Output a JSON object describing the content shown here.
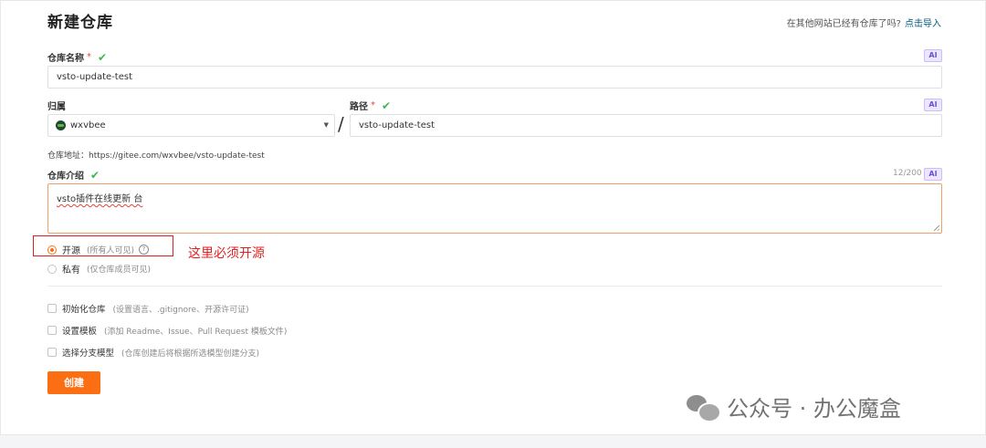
{
  "header": {
    "title": "新建仓库",
    "import_prompt": "在其他网站已经有仓库了吗?",
    "import_link": "点击导入"
  },
  "repo_name": {
    "label": "仓库名称",
    "required_mark": "*",
    "value": "vsto-update-test",
    "ai_badge": "AI"
  },
  "owner": {
    "label": "归属",
    "value": "wxvbee"
  },
  "separator": "/",
  "path": {
    "label": "路径",
    "required_mark": "*",
    "value": "vsto-update-test",
    "ai_badge": "AI"
  },
  "address": "仓库地址：https://gitee.com/wxvbee/vsto-update-test",
  "description": {
    "label": "仓库介绍",
    "counter": "12/200",
    "value": "vsto插件在线更新 台",
    "ai_badge": "AI"
  },
  "visibility": {
    "public_label": "开源",
    "public_hint": "(所有人可见)",
    "private_label": "私有",
    "private_hint": "(仅仓库成员可见)",
    "selected": "public",
    "help_glyph": "?"
  },
  "annotation": "这里必须开源",
  "options": [
    {
      "label": "初始化仓库",
      "hint": "(设置语言、.gitignore、开源许可证)"
    },
    {
      "label": "设置模板",
      "hint": "(添加 Readme、Issue、Pull Request 模板文件)"
    },
    {
      "label": "选择分支模型",
      "hint": "(仓库创建后将根据所选模型创建分支)"
    }
  ],
  "create_button": "创建",
  "watermark": "公众号 · 办公魔盒",
  "colors": {
    "accent": "#fc6e14",
    "check": "#3fb64c",
    "annotation": "#e02020",
    "link": "#005980"
  }
}
